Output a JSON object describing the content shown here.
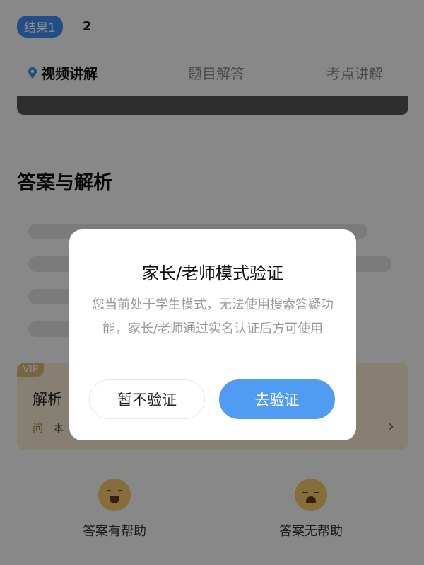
{
  "top_tabs": {
    "result1": "结果1",
    "result2": "2"
  },
  "sub_tabs": [
    {
      "label": "视频讲解",
      "active": true
    },
    {
      "label": "题目解答",
      "active": false
    },
    {
      "label": "考点讲解",
      "active": false
    }
  ],
  "section": {
    "title": "答案与解析"
  },
  "vip_card": {
    "badge": "VIP",
    "title": "解析",
    "question_prefix": "问",
    "question_text": "本",
    "chevron": "›"
  },
  "feedback": {
    "helpful": {
      "label": "答案有帮助",
      "icon": "happy-face-icon"
    },
    "not_helpful": {
      "label": "答案无帮助",
      "icon": "crying-face-icon"
    }
  },
  "dialog": {
    "title": "家长/老师模式验证",
    "body": "您当前处于学生模式，无法使用搜索答疑功能，家长/老师通过实名认证后方可使用",
    "cancel_label": "暂不验证",
    "confirm_label": "去验证"
  },
  "colors": {
    "accent": "#4f9cf2",
    "pill": "#3d8ef0",
    "overlay": "rgba(0,0,0,0.45)"
  }
}
